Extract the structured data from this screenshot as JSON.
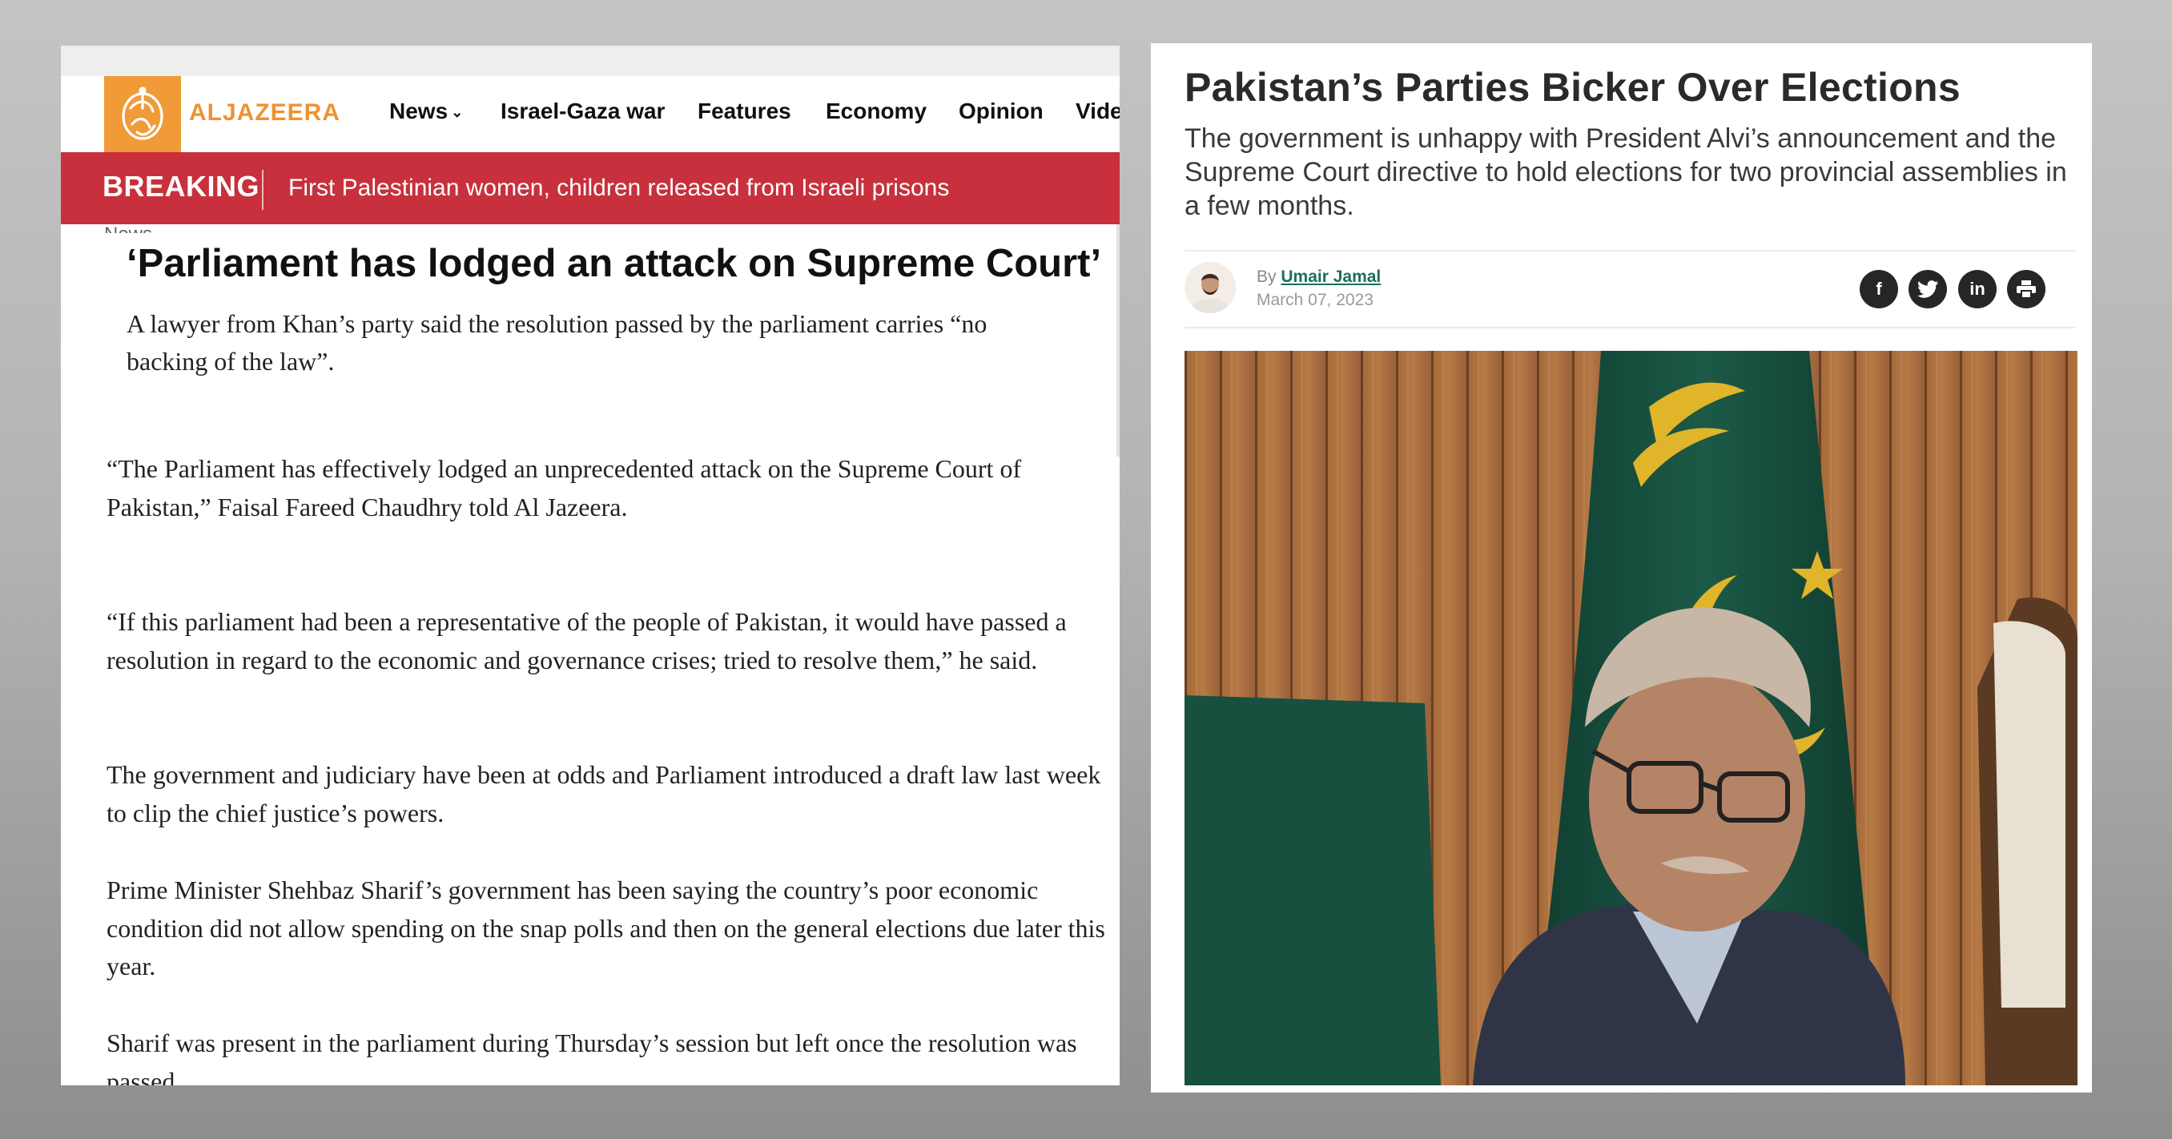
{
  "left": {
    "logo_text": "ALJAZEERA",
    "nav": [
      "News",
      "Israel-Gaza war",
      "Features",
      "Economy",
      "Opinion",
      "Vide"
    ],
    "breaking_label": "BREAKING",
    "breaking_text": "First Palestinian women, children released from Israeli prisons",
    "section_label": "News",
    "headline": "‘Parliament has lodged an attack on Supreme Court’",
    "standfirst": "A lawyer from Khan’s party said the resolution passed by the parliament carries “no backing of the law”.",
    "paragraphs": [
      "“The Parliament has effectively lodged an unprecedented attack on the Supreme Court of Pakistan,” Faisal Fareed Chaudhry told Al Jazeera.",
      "“If this parliament had been a representative of the people of Pakistan, it would have passed a resolution in regard to the economic and governance crises; tried to resolve them,” he said.",
      "The government and judiciary have been at odds and Parliament introduced a draft law last week to clip the chief justice’s powers.",
      "Prime Minister Shehbaz Sharif’s government has been saying the country’s poor eco­nomic condition did not allow spending on the snap polls and then on the general elec­tions due later this year.",
      "Sharif was present in the parliament during Thursday’s session but left once the resolu­tion was passed."
    ]
  },
  "right": {
    "title": "Pakistan’s Parties Bicker Over Elections",
    "subtitle": "The government is unhappy with President Alvi’s announcement and the Supreme Court directive to hold elections for two provincial assemblies in a few months.",
    "by_prefix": "By",
    "author": "Umair Jamal",
    "date": "March 07, 2023",
    "share_icons": [
      "facebook-icon",
      "twitter-icon",
      "linkedin-icon",
      "print-icon"
    ],
    "share_glyphs": [
      "f",
      "t",
      "in",
      "⎙"
    ]
  },
  "colors": {
    "aljazeera_orange": "#f09a38",
    "breaking_red": "#c8303d",
    "author_link": "#1c6f5a",
    "flag_green": "#17503f",
    "flag_gold": "#e0b52a"
  }
}
